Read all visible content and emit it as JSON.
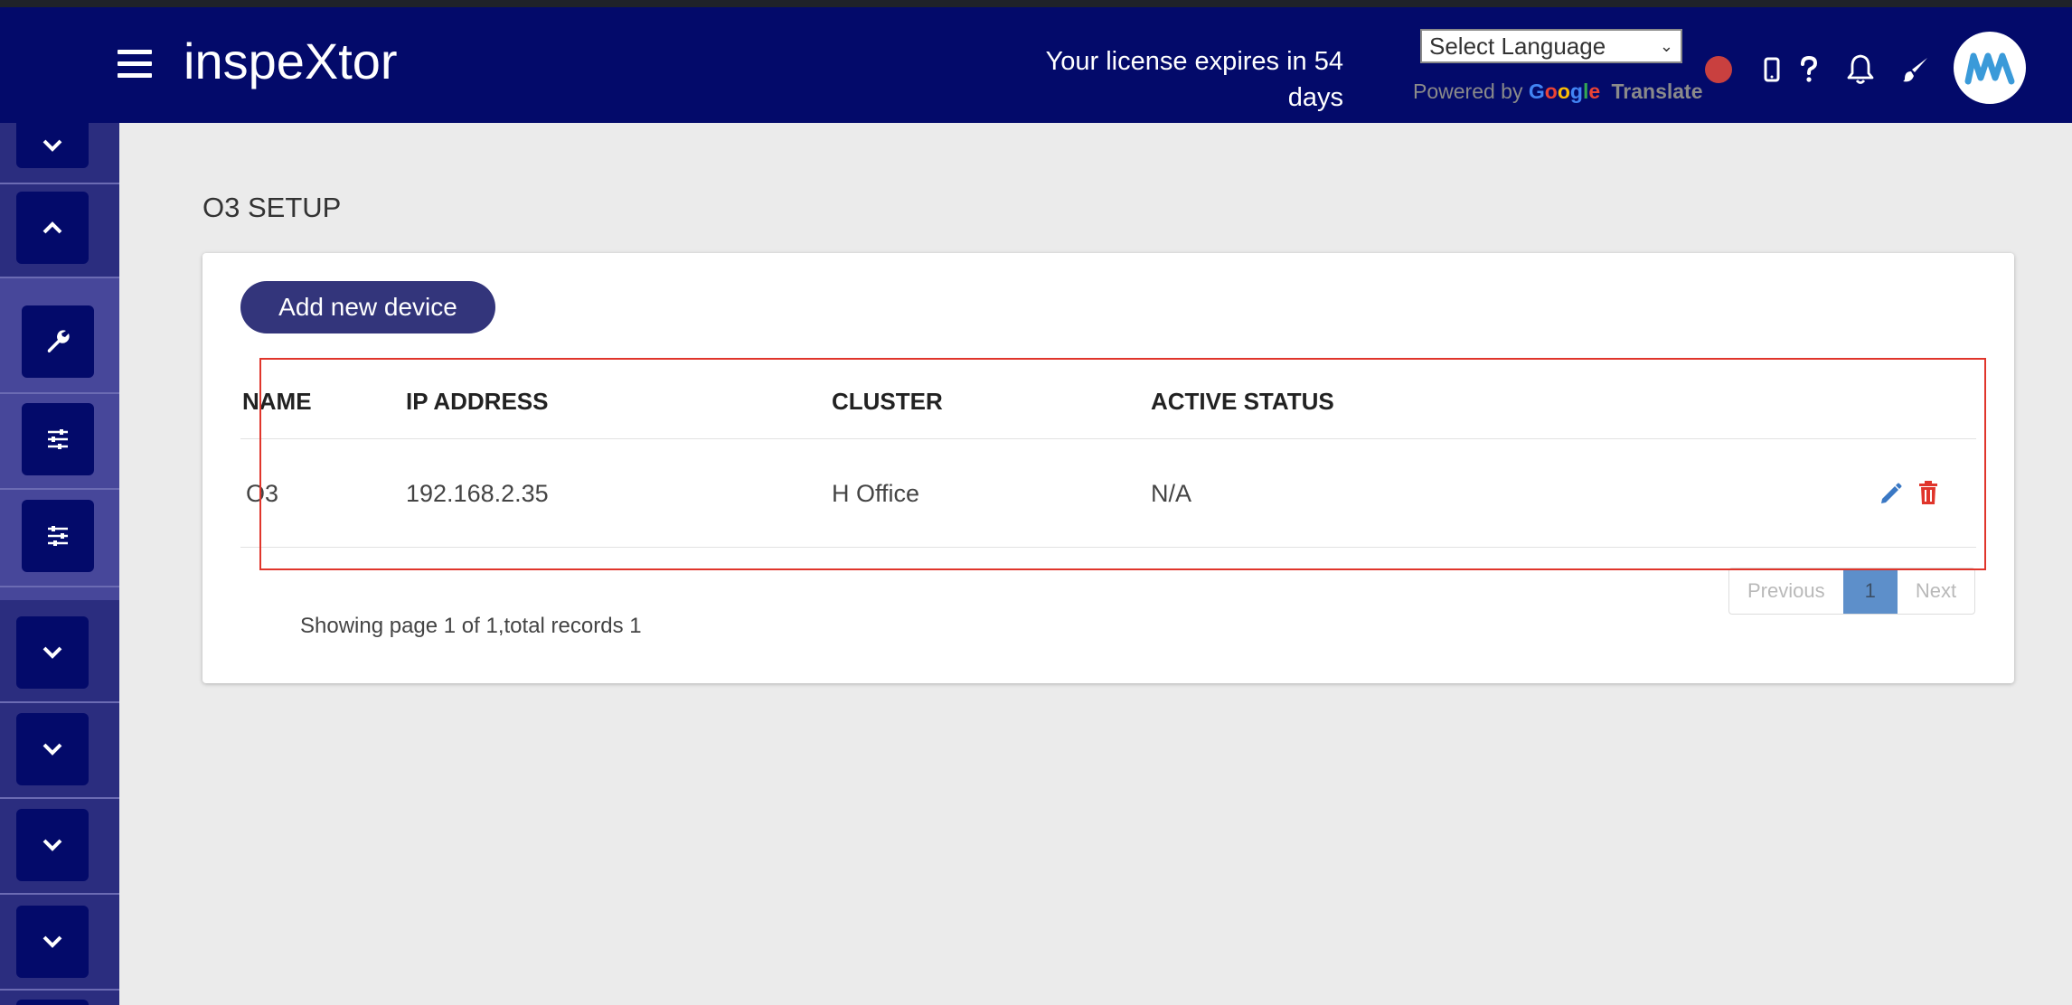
{
  "header": {
    "app_name": "inspeXtor",
    "license_line1": "Your license expires in 54",
    "license_line2": "days",
    "language_select": "Select Language",
    "powered_by": "Powered by",
    "google": "Google",
    "translate": "Translate"
  },
  "page": {
    "title": "O3 SETUP",
    "add_button": "Add new device"
  },
  "table": {
    "columns": [
      "NAME",
      "IP ADDRESS",
      "CLUSTER",
      "ACTIVE STATUS"
    ],
    "rows": [
      {
        "name": "O3",
        "ip": "192.168.2.35",
        "cluster": "H Office",
        "status": "N/A"
      }
    ]
  },
  "pagination": {
    "previous": "Previous",
    "current": "1",
    "next": "Next",
    "summary": "Showing page 1 of 1,total records 1"
  },
  "colors": {
    "header_bg": "#030a6a",
    "sidebar_bg": "#2b2d7f",
    "button_bg": "#33357b",
    "highlight_border": "#e0352b",
    "delete_icon": "#e0352b",
    "edit_icon": "#3a78c4",
    "active_page": "#5d8fca"
  },
  "icons": {
    "header": [
      "menu-icon",
      "status-dot",
      "mobile-icon",
      "help-icon",
      "bell-icon",
      "brush-icon",
      "user-avatar-logo"
    ],
    "sidebar": [
      "chevron-down-icon",
      "chevron-up-icon",
      "wrench-icon",
      "sliders-icon",
      "sliders-icon",
      "chevron-down-icon",
      "chevron-down-icon",
      "chevron-down-icon",
      "chevron-down-icon"
    ],
    "row_actions": [
      "pencil-icon",
      "trash-icon"
    ]
  }
}
